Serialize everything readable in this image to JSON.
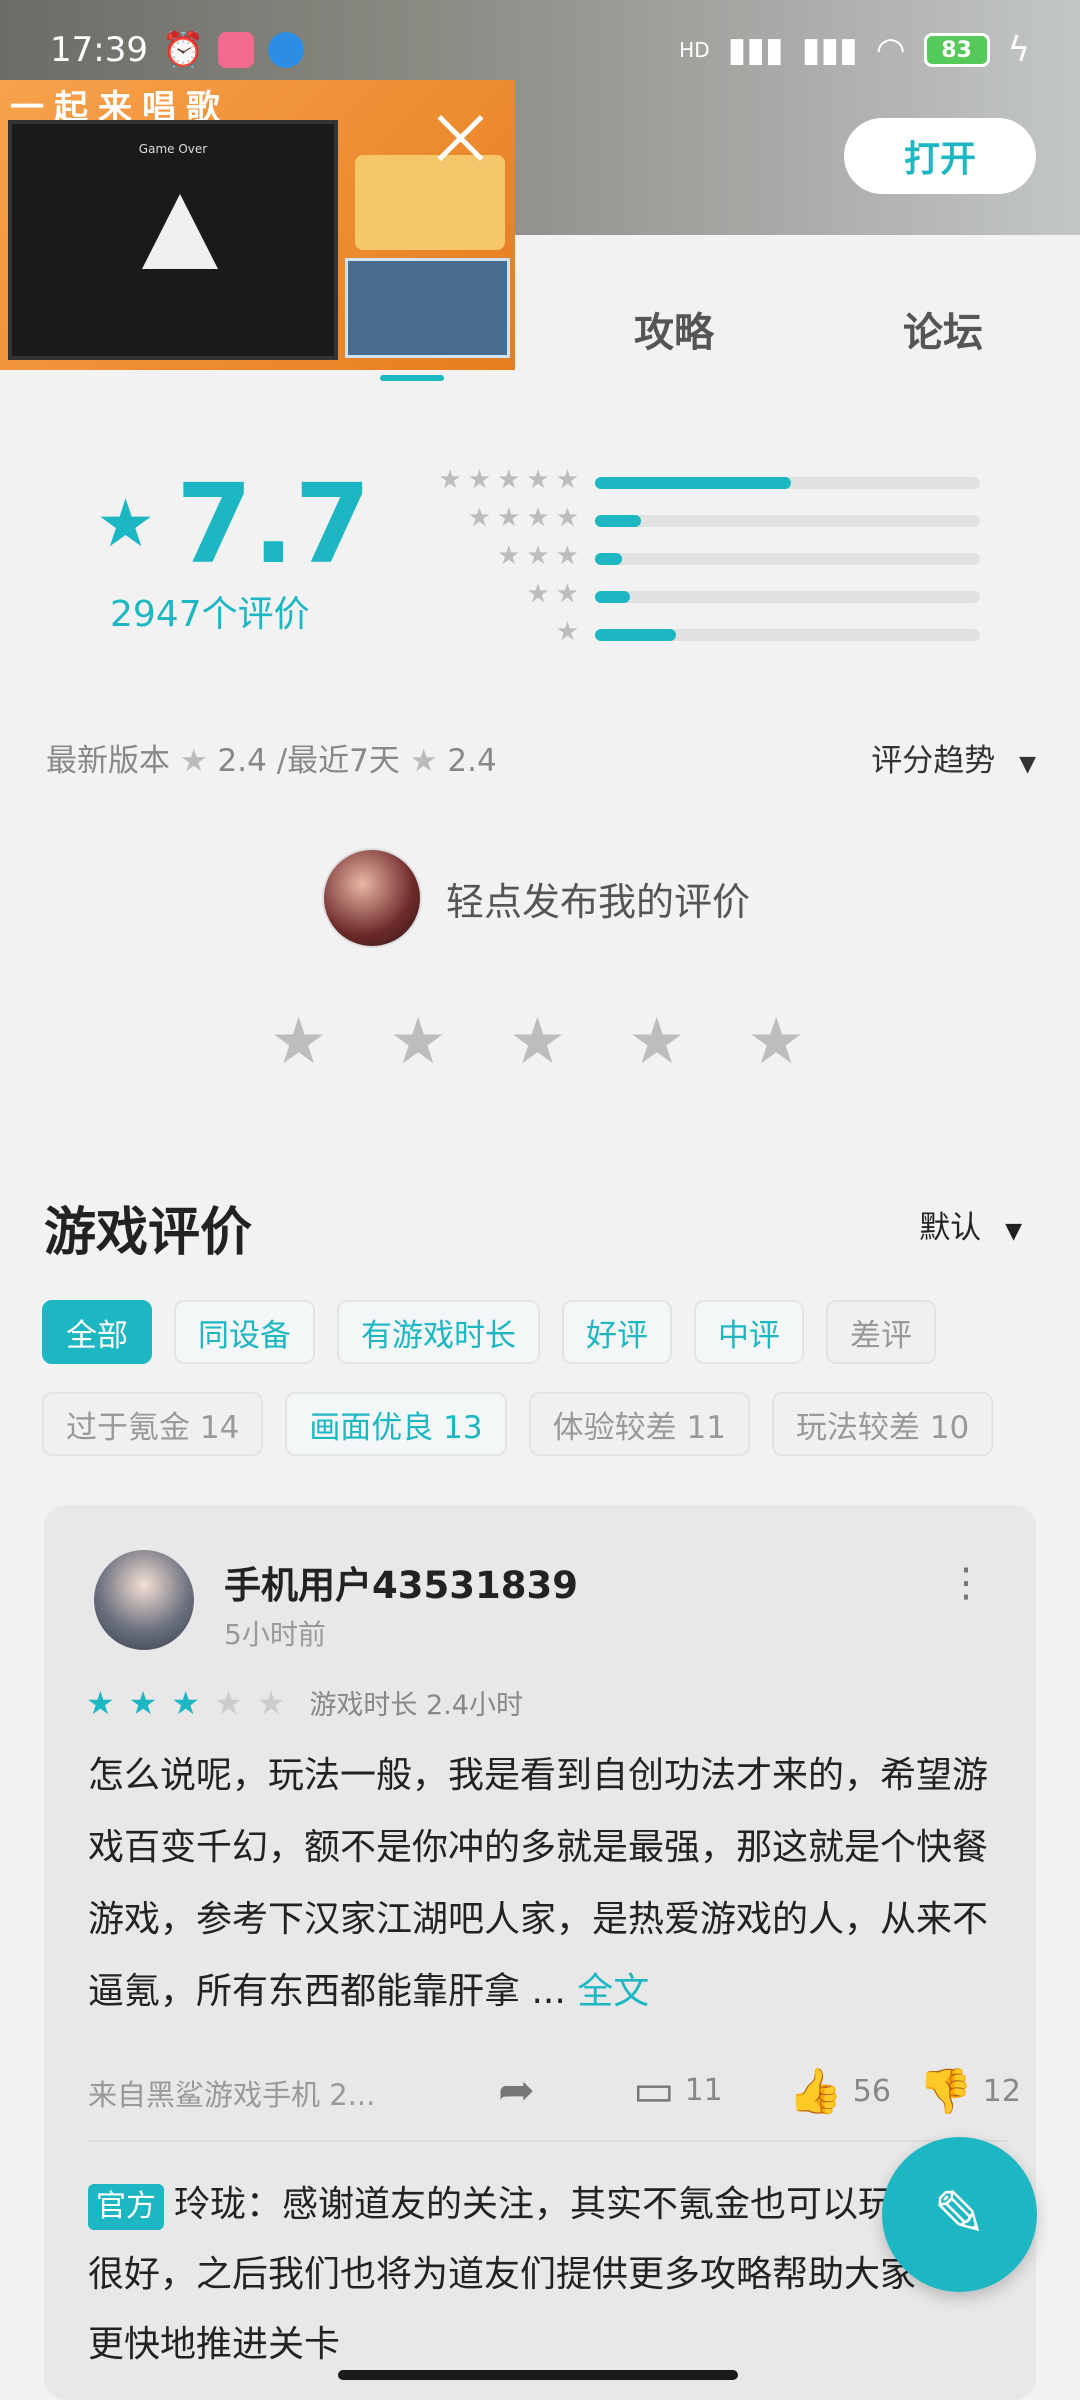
{
  "status_bar": {
    "time": "17:39",
    "battery": "83",
    "network": "HD"
  },
  "header": {
    "open_button": "打开"
  },
  "pip": {
    "title": "一起来唱歌",
    "game_text": "Game Over"
  },
  "tabs": [
    {
      "label": "攻略"
    },
    {
      "label": "论坛"
    }
  ],
  "rating": {
    "score": "7.7",
    "count_label": "2947个评价",
    "distribution": [
      {
        "stars": 5,
        "fraction": 0.51
      },
      {
        "stars": 4,
        "fraction": 0.12
      },
      {
        "stars": 3,
        "fraction": 0.07
      },
      {
        "stars": 2,
        "fraction": 0.09
      },
      {
        "stars": 1,
        "fraction": 0.21
      }
    ]
  },
  "version": {
    "label": "最新版本",
    "latest_score": "2.4",
    "recent_label": "/最近7天",
    "recent_score": "2.4",
    "trend": "评分趋势"
  },
  "post_review": {
    "prompt": "轻点发布我的评价"
  },
  "reviews_section": {
    "title": "游戏评价",
    "sort": "默认",
    "filters_row1": [
      {
        "label": "全部",
        "style": "active"
      },
      {
        "label": "同设备",
        "style": "teal"
      },
      {
        "label": "有游戏时长",
        "style": "teal"
      },
      {
        "label": "好评",
        "style": "teal"
      },
      {
        "label": "中评",
        "style": "teal"
      },
      {
        "label": "差评",
        "style": "gray"
      }
    ],
    "filters_row2": [
      {
        "label": "过于氪金 14",
        "style": "gray"
      },
      {
        "label": "画面优良 13",
        "style": "teal"
      },
      {
        "label": "体验较差 11",
        "style": "gray"
      },
      {
        "label": "玩法较差 10",
        "style": "gray"
      }
    ]
  },
  "review": {
    "user": "手机用户43531839",
    "time": "5小时前",
    "stars": 3,
    "playtime": "游戏时长 2.4小时",
    "body": "怎么说呢，玩法一般，我是看到自创功法才来的，希望游戏百变千幻，额不是你冲的多就是最强，那这就是个快餐游戏，参考下汉家江湖吧人家，是热爱游戏的人，从来不逼氪，所有东西都能靠肝拿 ...",
    "more": "全文",
    "device": "来自黑鲨游戏手机 2...",
    "comments": "11",
    "likes": "56",
    "dislikes": "12",
    "official_tag": "官方",
    "official_reply": "玲珑：感谢道友的关注，其实不氪金也可以玩的很好，之后我们也将为道友们提供更多攻略帮助大家更快地推进关卡"
  }
}
